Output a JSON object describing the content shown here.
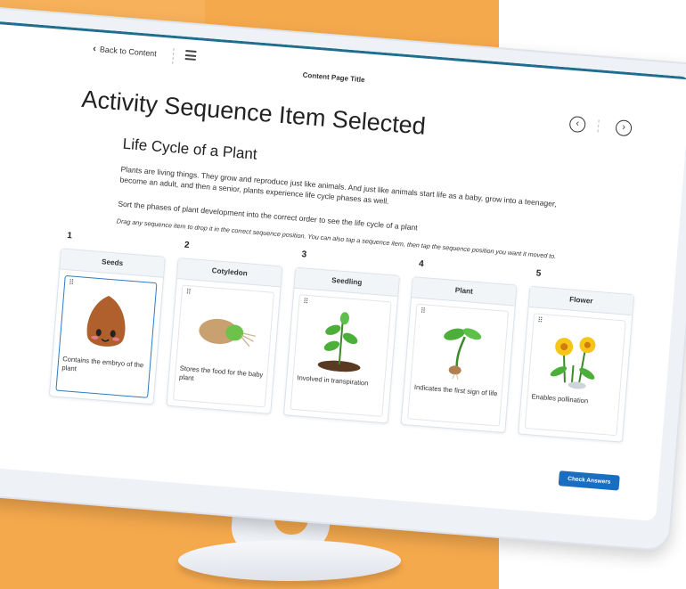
{
  "header": {
    "back_label": "Back to Content",
    "content_title": "Content Page Title"
  },
  "activity": {
    "title": "Activity Sequence Item Selected",
    "subtitle": "Life Cycle of a Plant",
    "description": "Plants are living things. They grow and reproduce just like animals. And just like animals start life as a baby, grow into a teenager, become an adult, and then a senior, plants experience life cycle phases as well.",
    "instruction": "Sort the phases of plant development into the correct order to see the life cycle of a plant",
    "hint": "Drag any sequence item to drop it in the correct sequence position. You can also tap a sequence item, then tap the sequence position you want it moved to."
  },
  "sequence": [
    {
      "position": "1",
      "header": "Seeds",
      "text": "Contains the embryo of the plant",
      "icon": "seed-icon",
      "selected": true
    },
    {
      "position": "2",
      "header": "Cotyledon",
      "text": "Stores the food for the baby plant",
      "icon": "cotyledon-icon",
      "selected": false
    },
    {
      "position": "3",
      "header": "Seedling",
      "text": "Involved in transpiration",
      "icon": "seedling-icon",
      "selected": false
    },
    {
      "position": "4",
      "header": "Plant",
      "text": "Indicates the first sign of life",
      "icon": "sprout-icon",
      "selected": false
    },
    {
      "position": "5",
      "header": "Flower",
      "text": "Enables pollination",
      "icon": "flower-icon",
      "selected": false
    }
  ],
  "actions": {
    "check_label": "Check Answers"
  },
  "colors": {
    "background": "#f5a94d",
    "accent": "#1a6ec2",
    "topline": "#1f6d8f"
  }
}
